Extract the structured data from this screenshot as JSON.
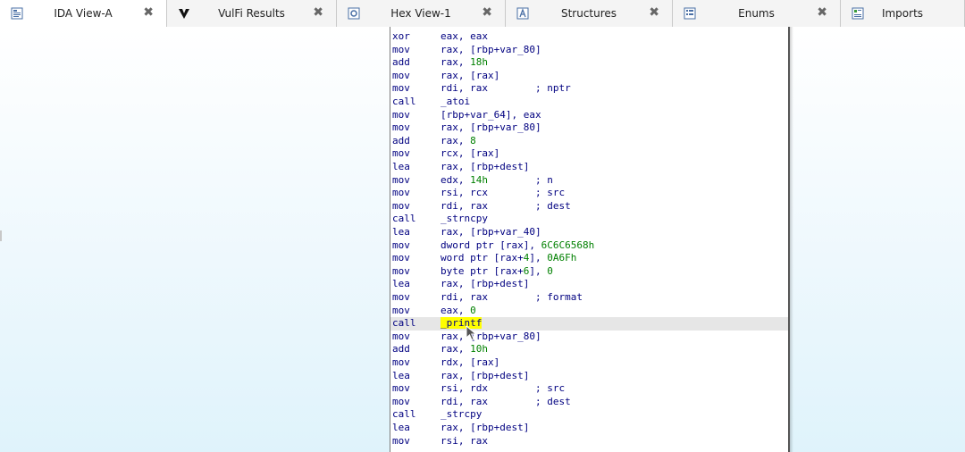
{
  "tabs": [
    {
      "label": "IDA View-A",
      "icon": "ida-view-icon",
      "closable": true,
      "active": true
    },
    {
      "label": "VulFi Results",
      "icon": "vulfi-icon",
      "closable": true,
      "active": false
    },
    {
      "label": "Hex View-1",
      "icon": "hex-view-icon",
      "closable": true,
      "active": false
    },
    {
      "label": "Structures",
      "icon": "structures-icon",
      "closable": true,
      "active": false
    },
    {
      "label": "Enums",
      "icon": "enums-icon",
      "closable": true,
      "active": false
    },
    {
      "label": "Imports",
      "icon": "imports-icon",
      "closable": false,
      "active": false
    }
  ],
  "close_glyph": "✖",
  "asm": {
    "lines": [
      {
        "m": "xor",
        "o": "eax, eax",
        "c": ""
      },
      {
        "m": "mov",
        "o": "rax, [rbp+var_80]",
        "c": ""
      },
      {
        "m": "add",
        "o": "rax, 18h",
        "c": ""
      },
      {
        "m": "mov",
        "o": "rax, [rax]",
        "c": ""
      },
      {
        "m": "mov",
        "o": "rdi, rax",
        "c": "; nptr"
      },
      {
        "m": "call",
        "o": "_atoi",
        "c": ""
      },
      {
        "m": "mov",
        "o": "[rbp+var_64], eax",
        "c": ""
      },
      {
        "m": "mov",
        "o": "rax, [rbp+var_80]",
        "c": ""
      },
      {
        "m": "add",
        "o": "rax, 8",
        "c": ""
      },
      {
        "m": "mov",
        "o": "rcx, [rax]",
        "c": ""
      },
      {
        "m": "lea",
        "o": "rax, [rbp+dest]",
        "c": ""
      },
      {
        "m": "mov",
        "o": "edx, 14h",
        "c": "; n"
      },
      {
        "m": "mov",
        "o": "rsi, rcx",
        "c": "; src"
      },
      {
        "m": "mov",
        "o": "rdi, rax",
        "c": "; dest"
      },
      {
        "m": "call",
        "o": "_strncpy",
        "c": ""
      },
      {
        "m": "lea",
        "o": "rax, [rbp+var_40]",
        "c": ""
      },
      {
        "m": "mov",
        "o": "dword ptr [rax], 6C6C6568h",
        "c": ""
      },
      {
        "m": "mov",
        "o": "word ptr [rax+4], 0A6Fh",
        "c": ""
      },
      {
        "m": "mov",
        "o": "byte ptr [rax+6], 0",
        "c": ""
      },
      {
        "m": "lea",
        "o": "rax, [rbp+dest]",
        "c": ""
      },
      {
        "m": "mov",
        "o": "rdi, rax",
        "c": "; format"
      },
      {
        "m": "mov",
        "o": "eax, 0",
        "c": ""
      },
      {
        "m": "call",
        "o": "_printf",
        "c": "",
        "highlight": true
      },
      {
        "m": "mov",
        "o": "rax, [rbp+var_80]",
        "c": ""
      },
      {
        "m": "add",
        "o": "rax, 10h",
        "c": ""
      },
      {
        "m": "mov",
        "o": "rdx, [rax]",
        "c": ""
      },
      {
        "m": "lea",
        "o": "rax, [rbp+dest]",
        "c": ""
      },
      {
        "m": "mov",
        "o": "rsi, rdx",
        "c": "; src"
      },
      {
        "m": "mov",
        "o": "rdi, rax",
        "c": "; dest"
      },
      {
        "m": "call",
        "o": "_strcpy",
        "c": ""
      },
      {
        "m": "lea",
        "o": "rax, [rbp+dest]",
        "c": ""
      },
      {
        "m": "mov",
        "o": "rsi, rax",
        "c": ""
      }
    ]
  },
  "colors": {
    "mnemonic": "#000080",
    "number": "#008000",
    "highlight": "#ffff00",
    "current_line": "#e6e6e6"
  }
}
